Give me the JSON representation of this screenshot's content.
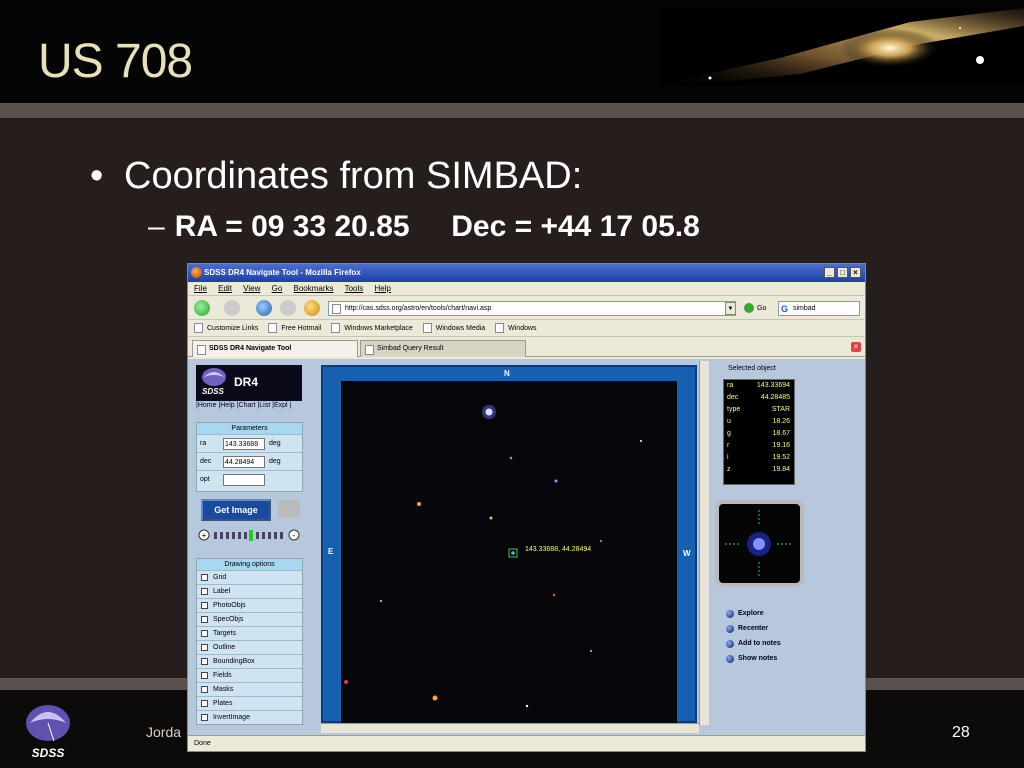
{
  "slide": {
    "title": "US 708",
    "bullet_main": "Coordinates from SIMBAD:",
    "bullet_sub_dash": "–",
    "bullet_sub": "RA = 09 33 20.85     Dec = +44 17 05.8",
    "footer_author": "Jorda",
    "page_number": "28",
    "logo_text": "SDSS"
  },
  "browser": {
    "window_title": "SDSS DR4 Navigate Tool - Mozilla Firefox",
    "menu": [
      "File",
      "Edit",
      "View",
      "Go",
      "Bookmarks",
      "Tools",
      "Help"
    ],
    "url": "http://cas.sdss.org/astro/en/tools/chart/navi.asp",
    "go_label": "Go",
    "search_value": "simbad",
    "bookmarks": [
      "Customize Links",
      "Free Hotmail",
      "Windows Marketplace",
      "Windows Media",
      "Windows"
    ],
    "tabs": [
      "SDSS DR4 Navigate Tool",
      "Simbad Query Result"
    ],
    "status": "Done"
  },
  "navigate": {
    "logo_text": "DR4",
    "logo_sub": "SDSS",
    "top_links": "|Home |Help |Chart |List |Expl |",
    "params_header": "Parameters",
    "params": [
      {
        "label": "ra",
        "value": "143.33688",
        "unit": "deg"
      },
      {
        "label": "dec",
        "value": "44.28494",
        "unit": "deg"
      },
      {
        "label": "opt",
        "value": "",
        "unit": ""
      }
    ],
    "get_image": "Get Image",
    "drawing_header": "Drawing options",
    "drawing_options": [
      "Grid",
      "Label",
      "PhotoObjs",
      "SpecObjs",
      "Targets",
      "Outline",
      "BoundingBox",
      "Fields",
      "Masks",
      "Plates",
      "InvertImage"
    ],
    "compass": {
      "n": "N",
      "e": "E",
      "w": "W"
    },
    "marker_label": "143.33688, 44.28494",
    "selected_header": "Selected object",
    "selected": [
      {
        "k": "ra",
        "v": "143.33694"
      },
      {
        "k": "dec",
        "v": "44.28485"
      },
      {
        "k": "type",
        "v": "STAR"
      },
      {
        "k": "u",
        "v": "18.26"
      },
      {
        "k": "g",
        "v": "18.67"
      },
      {
        "k": "r",
        "v": "19.16"
      },
      {
        "k": "i",
        "v": "19.52"
      },
      {
        "k": "z",
        "v": "19.84"
      }
    ],
    "actions": [
      "Explore",
      "Recenter",
      "Add to notes",
      "Show notes"
    ]
  },
  "colors": {
    "slide_title": "#e8e0b8",
    "sky_frame": "#1560b0",
    "panel_bg": "#b8c8dc",
    "selected_text": "#ffff80"
  }
}
